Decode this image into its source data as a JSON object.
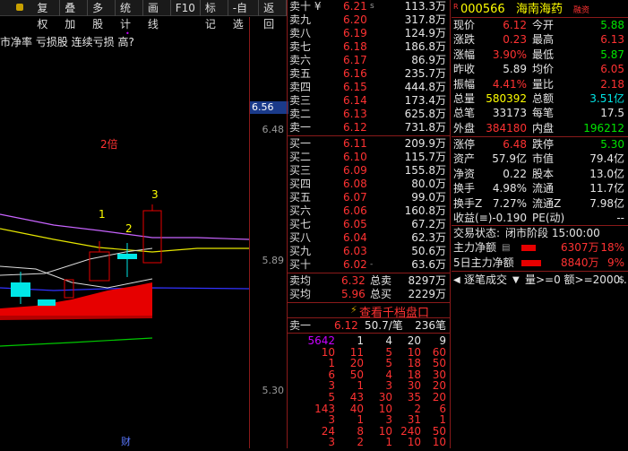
{
  "toolbar": {
    "items": [
      "复权",
      "叠加",
      "多股",
      "统计",
      "画线",
      "F10",
      "标记",
      "-自选",
      "返回"
    ]
  },
  "chart": {
    "indicator_text": "市净率 亏损股 连续亏损 高?",
    "annotations": [
      "2倍",
      "1",
      "2",
      "3"
    ],
    "axis_labels": [
      "6.56",
      "6.48",
      "5.89",
      "5.30"
    ],
    "bottom_tag": "财"
  },
  "orderbook": {
    "asks": [
      {
        "label": "卖十 ¥",
        "price": "6.21",
        "vol": "113.3万",
        "mark": "s"
      },
      {
        "label": "卖九",
        "price": "6.20",
        "vol": "317.8万",
        "mark": ""
      },
      {
        "label": "卖八",
        "price": "6.19",
        "vol": "124.9万",
        "mark": ""
      },
      {
        "label": "卖七",
        "price": "6.18",
        "vol": "186.8万",
        "mark": ""
      },
      {
        "label": "卖六",
        "price": "6.17",
        "vol": "86.9万",
        "mark": ""
      },
      {
        "label": "卖五",
        "price": "6.16",
        "vol": "235.7万",
        "mark": ""
      },
      {
        "label": "卖四",
        "price": "6.15",
        "vol": "444.8万",
        "mark": ""
      },
      {
        "label": "卖三",
        "price": "6.14",
        "vol": "173.4万",
        "mark": ""
      },
      {
        "label": "卖二",
        "price": "6.13",
        "vol": "625.8万",
        "mark": ""
      },
      {
        "label": "卖一",
        "price": "6.12",
        "vol": "731.8万",
        "mark": ""
      }
    ],
    "bids": [
      {
        "label": "买一",
        "price": "6.11",
        "vol": "209.9万",
        "mark": ""
      },
      {
        "label": "买二",
        "price": "6.10",
        "vol": "115.7万",
        "mark": ""
      },
      {
        "label": "买三",
        "price": "6.09",
        "vol": "155.8万",
        "mark": ""
      },
      {
        "label": "买四",
        "price": "6.08",
        "vol": "80.0万",
        "mark": ""
      },
      {
        "label": "买五",
        "price": "6.07",
        "vol": "99.0万",
        "mark": ""
      },
      {
        "label": "买六",
        "price": "6.06",
        "vol": "160.8万",
        "mark": ""
      },
      {
        "label": "买七",
        "price": "6.05",
        "vol": "67.2万",
        "mark": ""
      },
      {
        "label": "买八",
        "price": "6.04",
        "vol": "62.3万",
        "mark": ""
      },
      {
        "label": "买九",
        "price": "6.03",
        "vol": "50.6万",
        "mark": ""
      },
      {
        "label": "买十",
        "price": "6.02",
        "vol": "63.6万",
        "mark": "-"
      }
    ],
    "avg_sell": {
      "label": "卖均",
      "price": "6.32",
      "total_label": "总卖",
      "total": "8297万"
    },
    "avg_buy": {
      "label": "买均",
      "price": "5.96",
      "total_label": "总买",
      "total": "2229万"
    },
    "depth_button": "查看千档盘口",
    "tick_header": {
      "label": "卖一",
      "price": "6.12",
      "per": "50.7/笔",
      "count": "236笔"
    },
    "ticks": [
      [
        "5642",
        "1",
        "4",
        "20",
        "9"
      ],
      [
        "10",
        "11",
        "5",
        "10",
        "60"
      ],
      [
        "1",
        "20",
        "5",
        "18",
        "50"
      ],
      [
        "6",
        "50",
        "4",
        "18",
        "30"
      ],
      [
        "3",
        "1",
        "3",
        "30",
        "20"
      ],
      [
        "5",
        "43",
        "30",
        "35",
        "20"
      ],
      [
        "143",
        "40",
        "10",
        "2",
        "6"
      ],
      [
        "3",
        "1",
        "3",
        "31",
        "1"
      ],
      [
        "24",
        "8",
        "10",
        "240",
        "50"
      ],
      [
        "3",
        "2",
        "1",
        "10",
        "10"
      ]
    ]
  },
  "info": {
    "code": "000566",
    "name": "海南海药",
    "badge": "R",
    "tag": "融资",
    "rows": [
      {
        "l1": "现价",
        "v1": "6.12",
        "l2": "今开",
        "v2": "5.88"
      },
      {
        "l1": "涨跌",
        "v1": "0.23",
        "l2": "最高",
        "v2": "6.13"
      },
      {
        "l1": "涨幅",
        "v1": "3.90%",
        "l2": "最低",
        "v2": "5.87"
      },
      {
        "l1": "昨收",
        "v1": "5.89",
        "l2": "均价",
        "v2": "6.05"
      },
      {
        "l1": "振幅",
        "v1": "4.41%",
        "l2": "量比",
        "v2": "2.18"
      },
      {
        "l1": "总量",
        "v1": "580392",
        "l2": "总额",
        "v2": "3.51亿"
      },
      {
        "l1": "总笔",
        "v1": "33173",
        "l2": "每笔",
        "v2": "17.5"
      },
      {
        "l1": "外盘",
        "v1": "384180",
        "l2": "内盘",
        "v2": "196212"
      }
    ],
    "rows2": [
      {
        "l1": "涨停",
        "v1": "6.48",
        "l2": "跌停",
        "v2": "5.30"
      },
      {
        "l1": "资产",
        "v1": "57.9亿",
        "l2": "市值",
        "v2": "79.4亿"
      },
      {
        "l1": "净资",
        "v1": "0.22",
        "l2": "股本",
        "v2": "13.0亿"
      },
      {
        "l1": "换手",
        "v1": "4.98%",
        "l2": "流通",
        "v2": "11.7亿"
      },
      {
        "l1": "换手Z",
        "v1": "7.27%",
        "l2": "流通Z",
        "v2": "7.98亿"
      },
      {
        "l1": "收益(≡)",
        "v1": "-0.190",
        "l2": "PE(动)",
        "v2": "--"
      }
    ],
    "status_label": "交易状态:",
    "status_value": "闭市阶段 15:00:00",
    "main_flow_label": "主力净额",
    "main_flow_value": "6307万",
    "main_flow_pct": "18%",
    "flow5_label": "5日主力净额",
    "flow5_value": "8840万",
    "flow5_pct": "9%",
    "trade_label": "逐笔成交",
    "trade_filter": "量>=0 额>=2000..."
  }
}
